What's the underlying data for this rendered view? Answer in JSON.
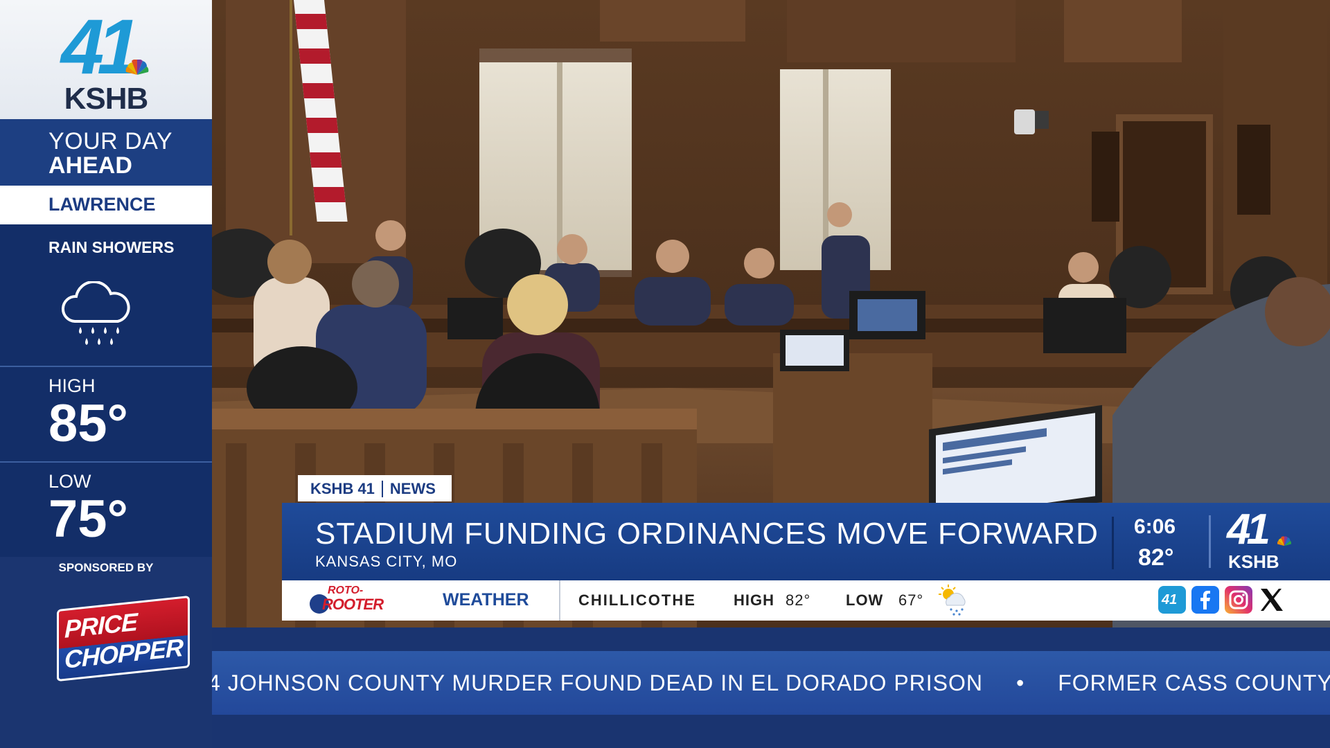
{
  "station": {
    "channel_number": "41",
    "call_sign": "KSHB"
  },
  "weather_panel": {
    "title_line1": "YOUR DAY",
    "title_line2": "AHEAD",
    "city": "LAWRENCE",
    "condition": "RAIN SHOWERS",
    "condition_icon": "cloud-rain-icon",
    "high_label": "HIGH",
    "high_value": "85°",
    "low_label": "LOW",
    "low_value": "75°",
    "sponsored_label": "SPONSORED BY",
    "sponsor_line1": "PRICE",
    "sponsor_line2": "CHOPPER"
  },
  "lower_third": {
    "tag_station": "KSHB 41",
    "tag_section": "NEWS",
    "headline": "STADIUM FUNDING ORDINANCES MOVE FORWARD",
    "location": "KANSAS CITY, MO",
    "time": "6:06",
    "current_temp": "82°"
  },
  "weather_bar": {
    "sponsor_line1": "ROTO-",
    "sponsor_line2": "ROOTER",
    "label": "WEATHER",
    "city": "CHILLICOTHE",
    "high_label": "HIGH",
    "high_value": "82°",
    "low_label": "LOW",
    "low_value": "67°",
    "icon": "sun-cloud-rain-icon",
    "social_icons": [
      "kshb-app-icon",
      "facebook-icon",
      "instagram-icon",
      "x-icon"
    ]
  },
  "ticker": {
    "items": [
      "4 JOHNSON COUNTY MURDER FOUND DEAD IN EL DORADO PRISON",
      "FORMER CASS COUNTY S"
    ],
    "separator": "•"
  },
  "colors": {
    "brand_blue": "#1f4b9a",
    "sidebar_navy": "#132e68",
    "logo_cyan": "#1e9ad6",
    "sponsor_red": "#d31d2c"
  }
}
